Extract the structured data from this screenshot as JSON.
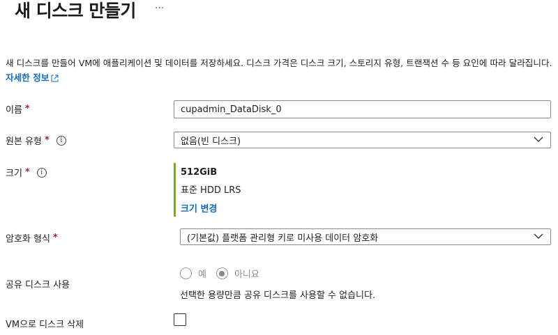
{
  "header": {
    "title": "새 디스크 만들기",
    "more": "..."
  },
  "description": {
    "text": "새 디스크를 만들어 VM에 애플리케이션 및 데이터를 저장하세요. 디스크 가격은 디스크 크기, 스토리지 유형, 트랜잭션 수 등 요인에 따라 달라집니다.",
    "link": "자세한 정보"
  },
  "fields": {
    "name": {
      "label": "이름",
      "required": "*",
      "value": "cupadmin_DataDisk_0"
    },
    "source_type": {
      "label": "원본 유형",
      "required": "*",
      "info_icon": "i",
      "value": "없음(빈 디스크)"
    },
    "size": {
      "label": "크기",
      "required": "*",
      "info_icon": "i",
      "value": "512GiB",
      "tier": "표준 HDD LRS",
      "change_link": "크기 변경"
    },
    "encryption": {
      "label": "암호화 형식",
      "required": "*",
      "value": "(기본값) 플랫폼 관리형 키로 미사용 데이터 암호화"
    },
    "shared_disk": {
      "label": "공유 디스크 사용",
      "option_yes": "예",
      "option_no": "아니요",
      "selected": "아니요",
      "note": "선택한 용량만큼 공유 디스크를 사용할 수 없습니다."
    },
    "delete_with_vm": {
      "label": "VM으로 디스크 삭제",
      "checked": false
    }
  },
  "colors": {
    "link": "#0f6cbd",
    "required": "#a4262c",
    "size_accent": "#6bb700"
  }
}
